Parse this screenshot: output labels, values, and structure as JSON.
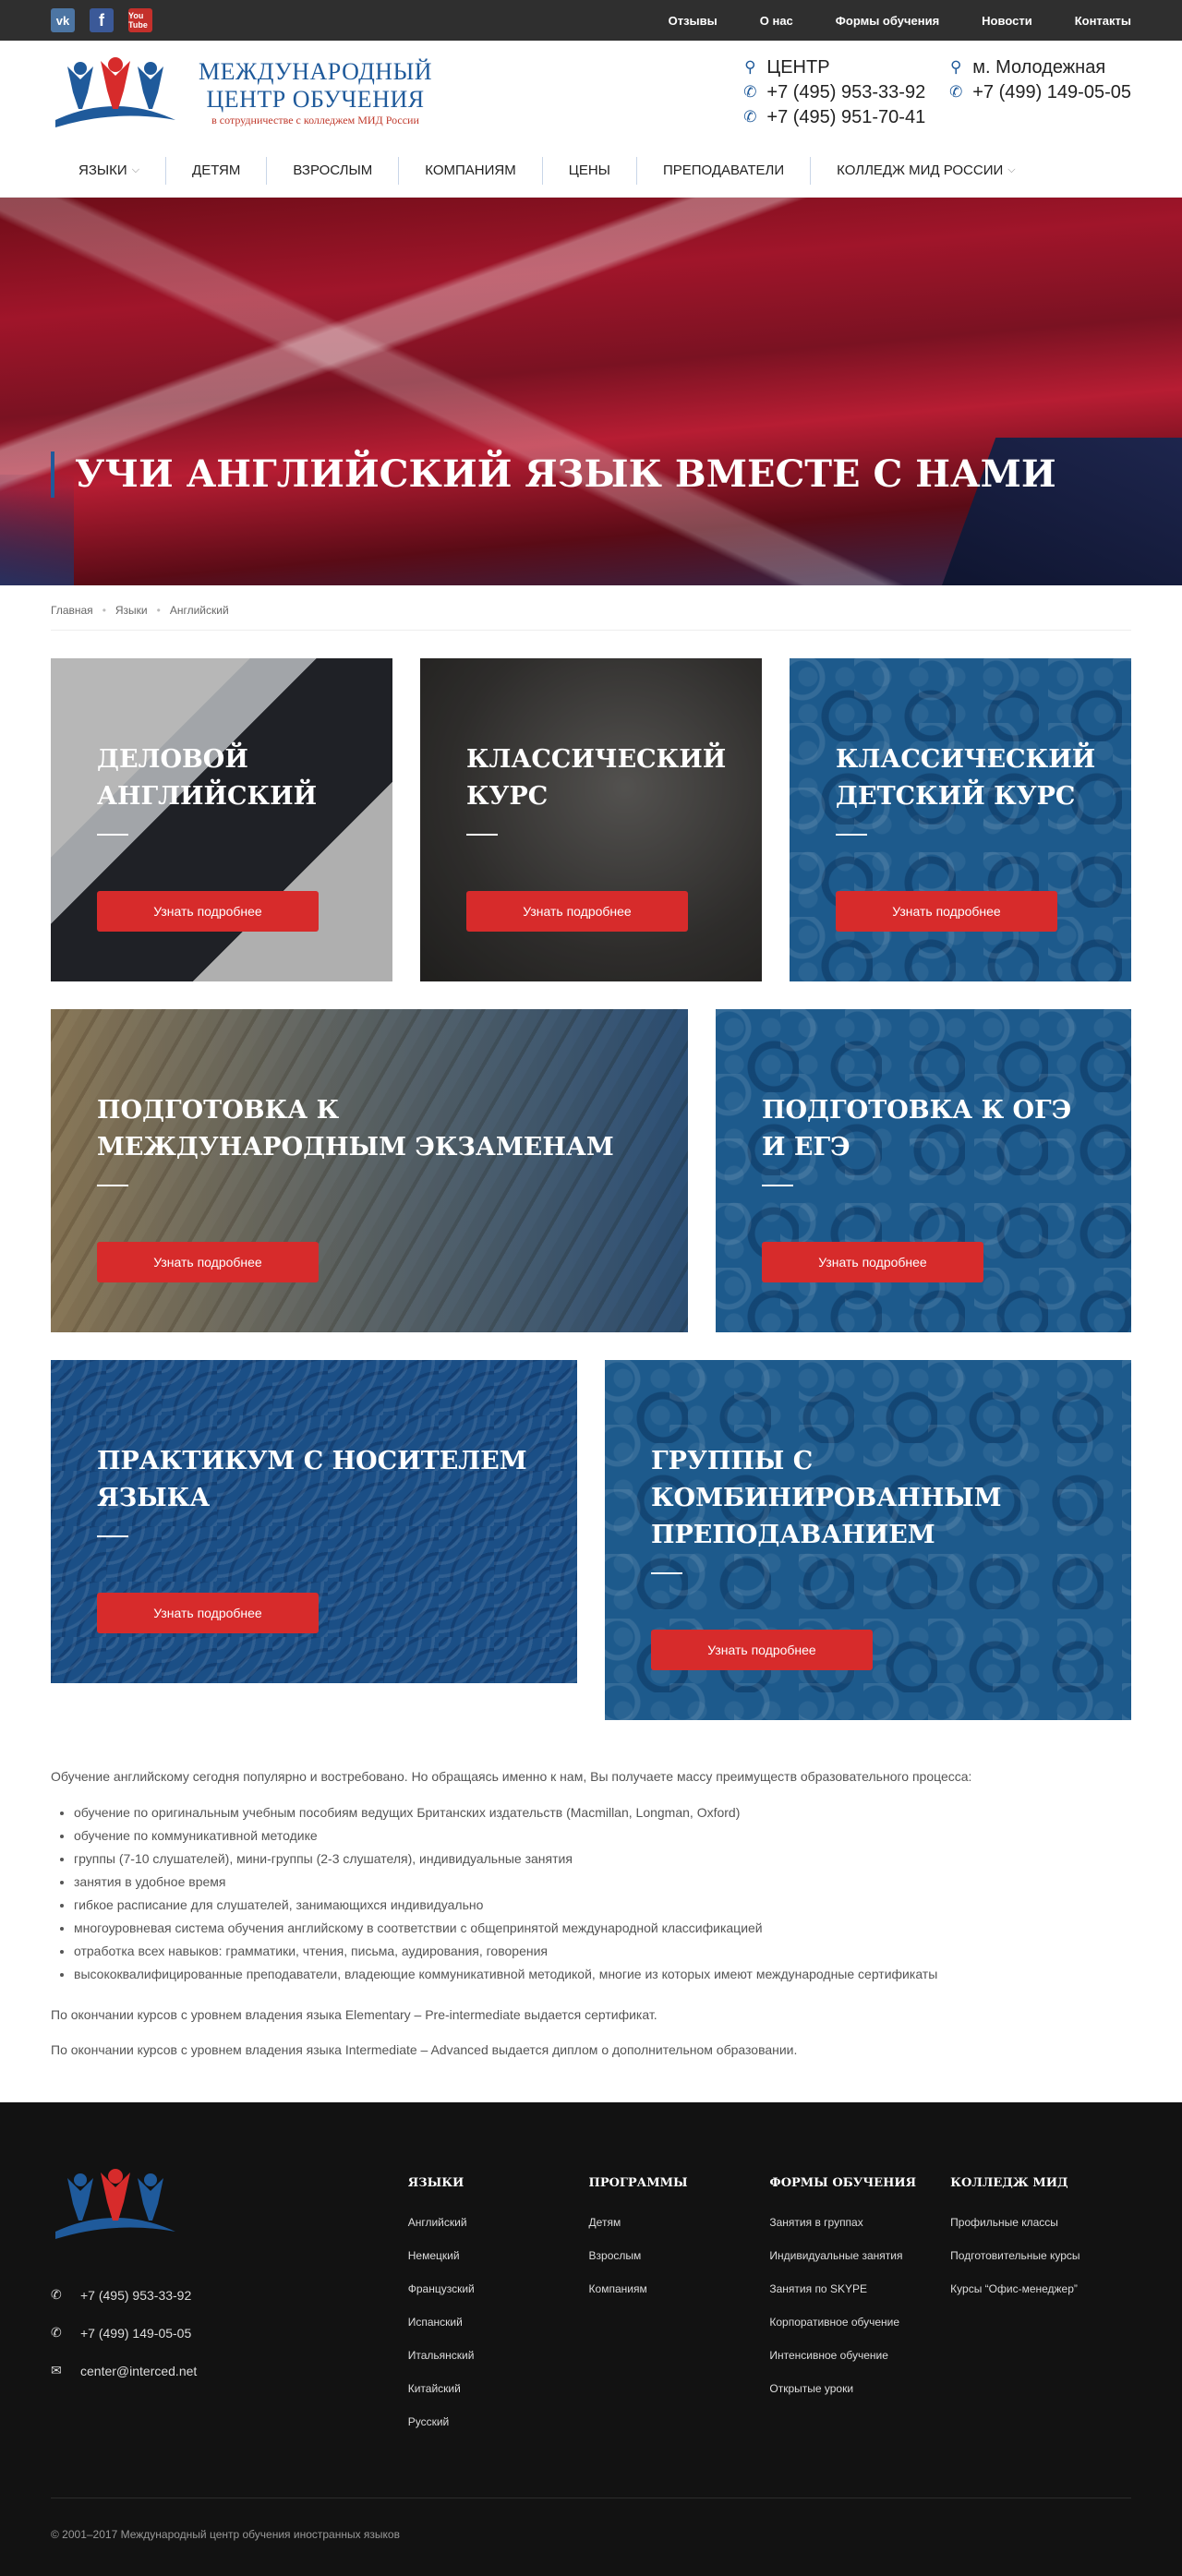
{
  "topbar": {
    "social": [
      {
        "name": "vk",
        "label": "vk"
      },
      {
        "name": "facebook",
        "label": "f"
      },
      {
        "name": "youtube",
        "label": "You Tube"
      }
    ],
    "links": [
      "Отзывы",
      "О нас",
      "Формы обучения",
      "Новости",
      "Контакты"
    ]
  },
  "header": {
    "logo_line1": "МЕЖДУНАРОДНЫЙ",
    "logo_line2": "ЦЕНТР ОБУЧЕНИЯ",
    "logo_line3": "в сотрудничестве с колледжем МИД России",
    "contacts": [
      {
        "icon": "map-marker-icon",
        "text": "ЦЕНТР"
      },
      {
        "icon": "map-marker-icon",
        "text": "м. Молодежная"
      },
      {
        "icon": "phone-icon",
        "text": "+7 (495) 953-33-92"
      },
      {
        "icon": "phone-icon",
        "text": "+7 (499) 149-05-05"
      },
      {
        "icon": "phone-icon",
        "text": "+7 (495) 951-70-41"
      }
    ]
  },
  "mainnav": [
    {
      "label": "ЯЗЫКИ",
      "dropdown": true
    },
    {
      "label": "ДЕТЯМ",
      "dropdown": false
    },
    {
      "label": "ВЗРОСЛЫМ",
      "dropdown": false
    },
    {
      "label": "КОМПАНИЯМ",
      "dropdown": false
    },
    {
      "label": "ЦЕНЫ",
      "dropdown": false
    },
    {
      "label": "ПРЕПОДАВАТЕЛИ",
      "dropdown": false
    },
    {
      "label": "КОЛЛЕДЖ МИД РОССИИ",
      "dropdown": true
    }
  ],
  "hero": {
    "title": "УЧИ АНГЛИЙСКИЙ ЯЗЫК ВМЕСТЕ С НАМИ"
  },
  "breadcrumb": [
    "Главная",
    "Языки",
    "Английский"
  ],
  "cards": [
    {
      "title": "ДЕЛОВОЙ АНГЛИЙСКИЙ",
      "button": "Узнать подробнее"
    },
    {
      "title": "КЛАССИЧЕСКИЙ КУРС",
      "button": "Узнать подробнее"
    },
    {
      "title": "КЛАССИЧЕСКИЙ ДЕТСКИЙ КУРС",
      "button": "Узнать подробнее"
    },
    {
      "title": "ПОДГОТОВКА К МЕЖДУНАРОДНЫМ ЭКЗАМЕНАМ",
      "button": "Узнать подробнее"
    },
    {
      "title": "ПОДГОТОВКА К ОГЭ И ЕГЭ",
      "button": "Узнать подробнее"
    },
    {
      "title": "ПРАКТИКУМ С НОСИТЕЛЕМ ЯЗЫКА",
      "button": "Узнать подробнее"
    },
    {
      "title": "ГРУППЫ С КОМБИНИРОВАННЫМ ПРЕПОДАВАНИЕМ",
      "button": "Узнать подробнее"
    }
  ],
  "content": {
    "intro": "Обучение английскому сегодня популярно и востребовано. Но обращаясь именно к нам, Вы получаете массу преимуществ образовательного процесса:",
    "bullets": [
      "обучение по оригинальным учебным пособиям ведущих Британских издательств (Macmillan, Longman, Oxford)",
      "обучение по коммуникативной методике",
      "группы (7-10 слушателей), мини-группы (2-3 слушателя), индивидуальные занятия",
      "занятия в удобное время",
      "гибкое расписание для слушателей, занимающихся индивидуально",
      "многоуровневая система обучения английскому в соответствии с общепринятой международной классификацией",
      "отработка всех навыков: грамматики, чтения, письма, аудирования, говорения",
      "высококвалифицированные преподаватели, владеющие коммуникативной методикой, многие из которых имеют международные сертификаты"
    ],
    "para1": "По окончании курсов с уровнем владения языка Elementary – Pre-intermediate выдается сертификат.",
    "para2": "По окончании курсов с уровнем владения языка Intermediate – Advanced выдается диплом о дополнительном образовании."
  },
  "footer": {
    "phone1": "+7 (495) 953-33-92",
    "phone2": "+7 (499) 149-05-05",
    "email": "center@interced.net",
    "columns": [
      {
        "title": "ЯЗЫКИ",
        "links": [
          "Английский",
          "Немецкий",
          "Французский",
          "Испанский",
          "Итальянский",
          "Китайский",
          "Русский"
        ]
      },
      {
        "title": "ПРОГРАММЫ",
        "links": [
          "Детям",
          "Взрослым",
          "Компаниям"
        ]
      },
      {
        "title": "ФОРМЫ ОБУЧЕНИЯ",
        "links": [
          "Занятия в группах",
          "Индивидуальные занятия",
          "Занятия по SKYPE",
          "Корпоративное обучение",
          "Интенсивное обучение",
          "Открытые уроки"
        ]
      },
      {
        "title": "КОЛЛЕДЖ МИД",
        "links": [
          "Профильные классы",
          "Подготовительные курсы",
          "Курсы “Офис-менеджер”"
        ]
      }
    ],
    "copyright": "© 2001–2017 Международный центр обучения иностранных языков"
  }
}
